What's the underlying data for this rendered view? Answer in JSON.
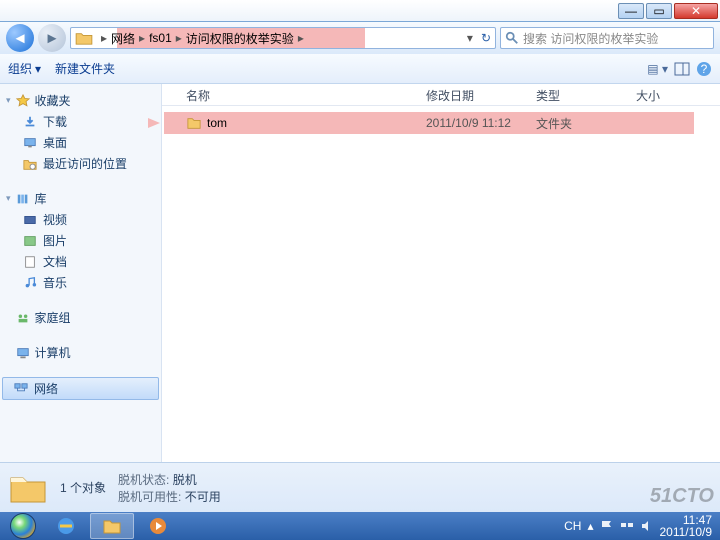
{
  "titlebar": {
    "min": "—",
    "max": "▭",
    "close": "✕"
  },
  "breadcrumb": {
    "parts": [
      "网络",
      "fs01",
      "访问权限的枚举实验"
    ],
    "sep": "▸"
  },
  "refresh": "↻",
  "search": {
    "placeholder": "搜索 访问权限的枚举实验"
  },
  "toolbar": {
    "organize": "组织",
    "newfolder": "新建文件夹"
  },
  "nav": {
    "favorites": {
      "label": "收藏夹",
      "items": [
        "下载",
        "桌面",
        "最近访问的位置"
      ]
    },
    "libraries": {
      "label": "库",
      "items": [
        "视频",
        "图片",
        "文档",
        "音乐"
      ]
    },
    "homegroup": "家庭组",
    "computer": "计算机",
    "network": "网络"
  },
  "columns": {
    "name": "名称",
    "date": "修改日期",
    "type": "类型",
    "size": "大小"
  },
  "rows": [
    {
      "name": "tom",
      "date": "2011/10/9 11:12",
      "type": "文件夹"
    }
  ],
  "status": {
    "count": "1 个对象",
    "l1": "脱机状态:",
    "v1": "脱机",
    "l2": "脱机可用性:",
    "v2": "不可用"
  },
  "tray": {
    "ime": "CH",
    "time": "11:47",
    "date": "2011/10/9"
  },
  "watermark": "51CTO"
}
